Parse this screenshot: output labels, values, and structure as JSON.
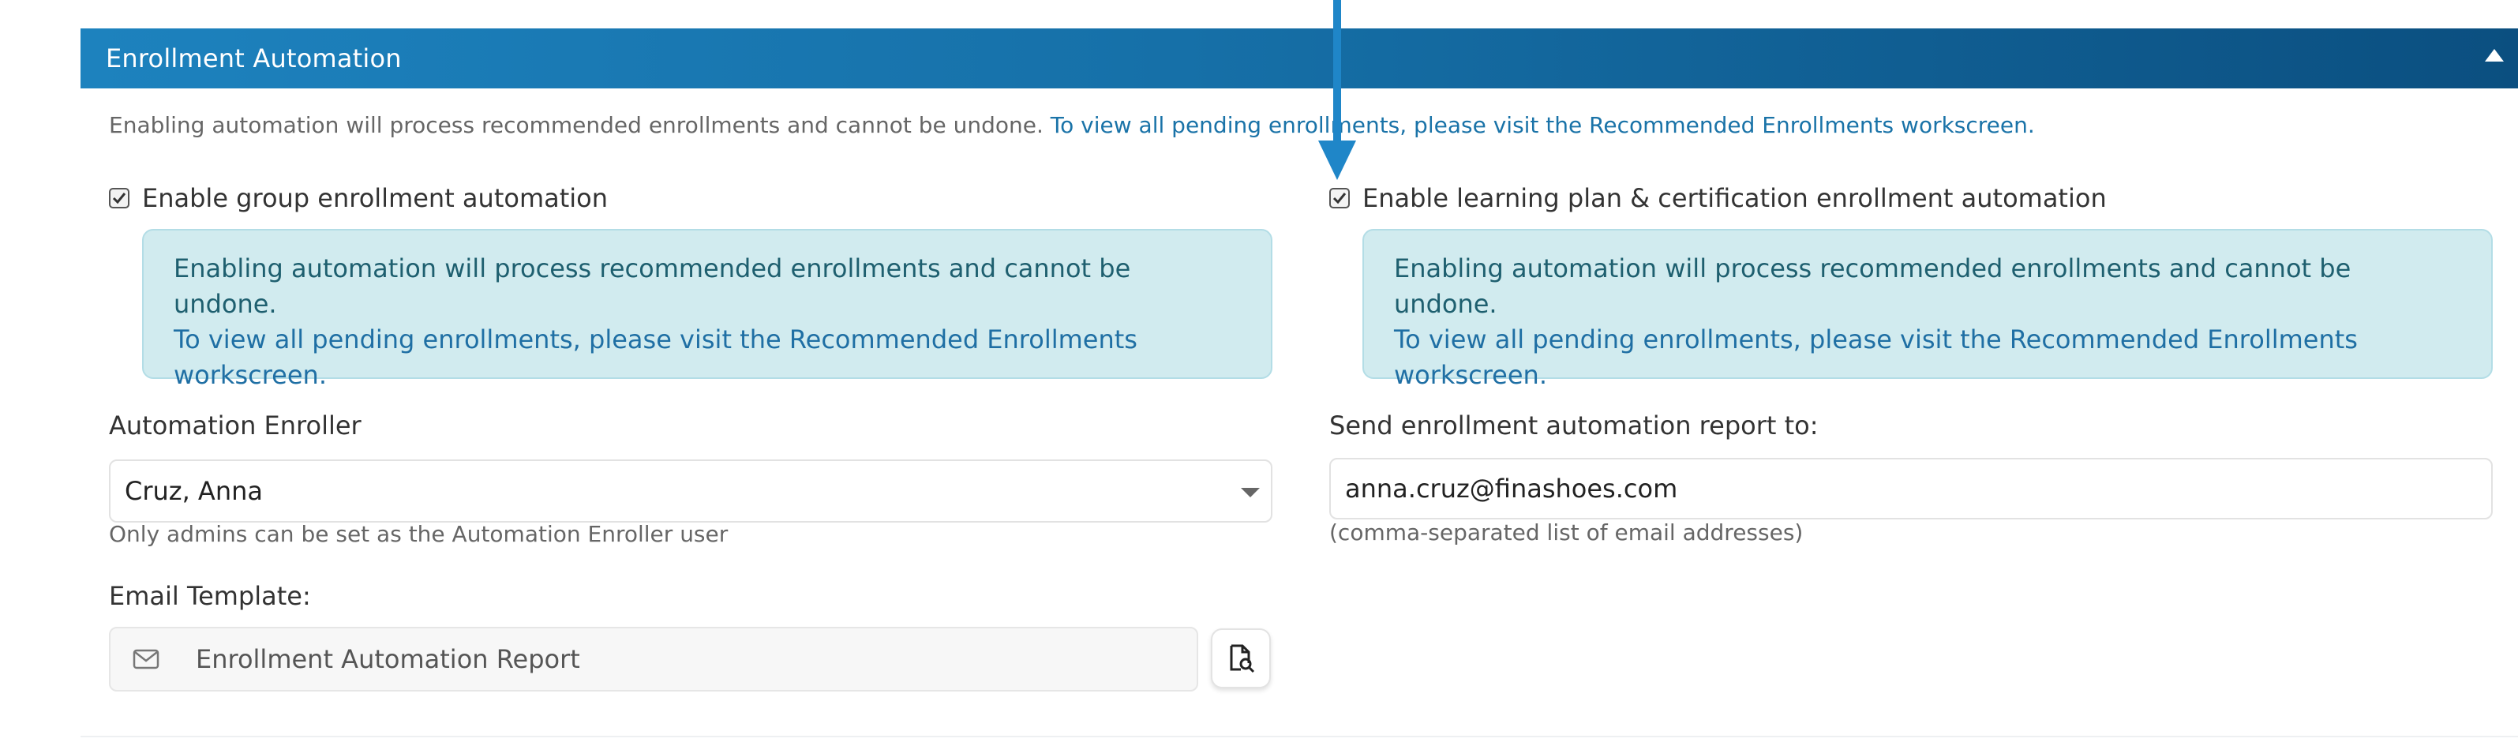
{
  "panel": {
    "title": "Enrollment Automation",
    "intro_text": "Enabling automation will process recommended enrollments and cannot be undone.",
    "intro_link": "To view all pending enrollments, please visit the Recommended Enrollments workscreen."
  },
  "group_automation": {
    "label": "Enable group enrollment automation",
    "checked": true,
    "info_line1": "Enabling automation will process recommended enrollments and cannot be undone.",
    "info_link": "To view all pending enrollments, please visit the Recommended Enrollments workscreen."
  },
  "lp_automation": {
    "label": "Enable learning plan & certification enrollment automation",
    "checked": true,
    "info_line1": "Enabling automation will process recommended enrollments and cannot be undone.",
    "info_link": "To view all pending enrollments, please visit the Recommended Enrollments workscreen."
  },
  "enroller": {
    "label": "Automation Enroller",
    "value": "Cruz, Anna",
    "help": "Only admins can be set as the Automation Enroller user"
  },
  "report": {
    "label": "Send enrollment automation report to:",
    "value": "anna.cruz@finashoes.com",
    "help": "(comma-separated list of email addresses)"
  },
  "email_template": {
    "label": "Email Template:",
    "value": "Enrollment Automation Report"
  },
  "colors": {
    "header_start": "#1d82be",
    "header_end": "#0b4f80",
    "info_bg": "#d1ebef",
    "link": "#1a73a8",
    "pointer": "#1f86c8"
  }
}
